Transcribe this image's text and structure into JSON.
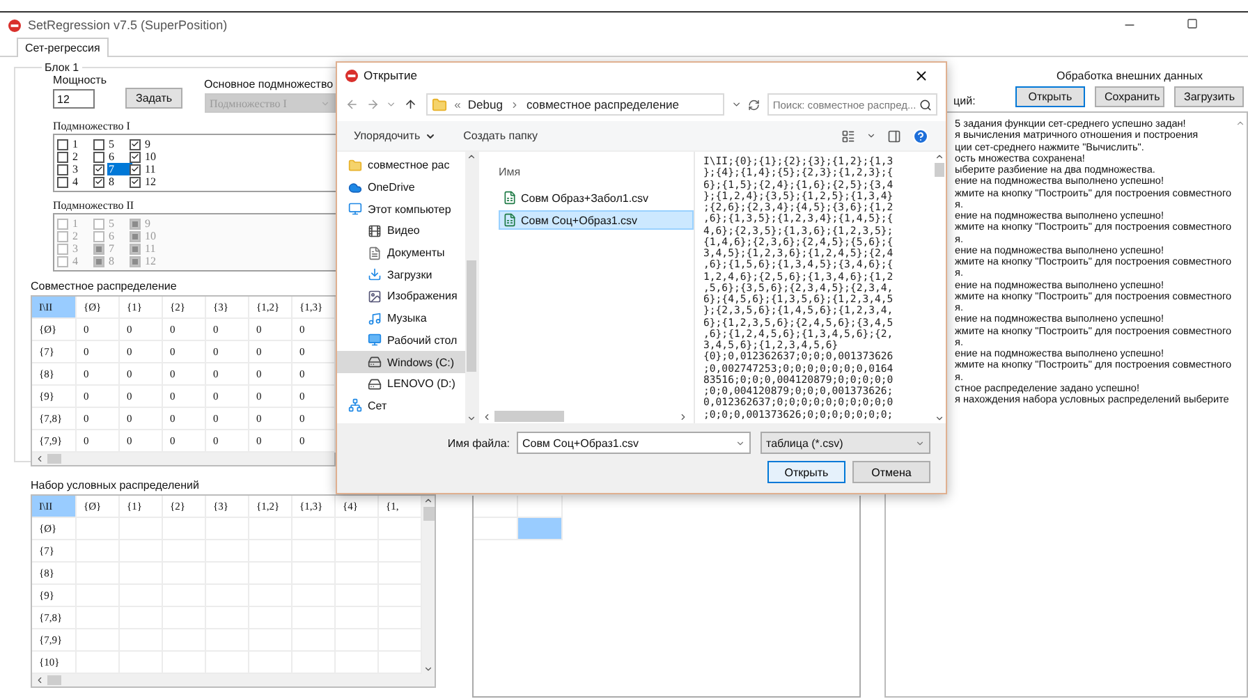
{
  "window": {
    "title": "SetRegression v7.5 (SuperPosition)"
  },
  "tabs": [
    {
      "label": "Сет-регрессия",
      "selected": true
    }
  ],
  "block": {
    "title": "Блок 1",
    "power_label": "Мощность",
    "power_value": "12",
    "set_button": "Задать",
    "main_subset_label": "Основное подмножество",
    "main_subset_value": "Подмножество I",
    "main_subset_disabled": true,
    "subset_1": {
      "label": "Подмножество I",
      "disabled": false,
      "items": [
        {
          "label": "1",
          "checked": false,
          "selected": false
        },
        {
          "label": "2",
          "checked": false,
          "selected": false
        },
        {
          "label": "3",
          "checked": false,
          "selected": false
        },
        {
          "label": "4",
          "checked": false,
          "selected": false
        },
        {
          "label": "5",
          "checked": false,
          "selected": false
        },
        {
          "label": "6",
          "checked": false,
          "selected": false
        },
        {
          "label": "7",
          "checked": true,
          "selected": true
        },
        {
          "label": "8",
          "checked": true,
          "selected": false
        },
        {
          "label": "9",
          "checked": true,
          "selected": false
        },
        {
          "label": "10",
          "checked": true,
          "selected": false
        },
        {
          "label": "11",
          "checked": true,
          "selected": false
        },
        {
          "label": "12",
          "checked": true,
          "selected": false
        }
      ]
    },
    "subset_2": {
      "label": "Подмножество II",
      "disabled": true,
      "items": [
        {
          "label": "1",
          "checked": false,
          "selected": false
        },
        {
          "label": "2",
          "checked": false,
          "selected": false
        },
        {
          "label": "3",
          "checked": false,
          "selected": false
        },
        {
          "label": "4",
          "checked": false,
          "selected": false
        },
        {
          "label": "5",
          "checked": false,
          "selected": false
        },
        {
          "label": "6",
          "checked": false,
          "selected": false
        },
        {
          "label": "7",
          "checked": true,
          "selected": false
        },
        {
          "label": "8",
          "checked": true,
          "selected": false
        },
        {
          "label": "9",
          "checked": true,
          "selected": false
        },
        {
          "label": "10",
          "checked": true,
          "selected": false
        },
        {
          "label": "11",
          "checked": true,
          "selected": false
        },
        {
          "label": "12",
          "checked": true,
          "selected": false
        }
      ]
    }
  },
  "joint": {
    "label": "Совместное распределение",
    "columns": [
      {
        "label": "I\\II",
        "selected": true
      },
      {
        "label": "{Ø}",
        "selected": false
      },
      {
        "label": "{1}",
        "selected": false
      },
      {
        "label": "{2}",
        "selected": false
      },
      {
        "label": "{3}",
        "selected": false
      },
      {
        "label": "{1,2}",
        "selected": false
      },
      {
        "label": "{1,3}",
        "selected": false
      }
    ],
    "rows": [
      {
        "cells": [
          "{Ø}",
          "0",
          "0",
          "0",
          "0",
          "0",
          "0"
        ]
      },
      {
        "cells": [
          "{7}",
          "0",
          "0",
          "0",
          "0",
          "0",
          "0"
        ]
      },
      {
        "cells": [
          "{8}",
          "0",
          "0",
          "0",
          "0",
          "0",
          "0"
        ]
      },
      {
        "cells": [
          "{9}",
          "0",
          "0",
          "0",
          "0",
          "0",
          "0"
        ]
      },
      {
        "cells": [
          "{7,8}",
          "0",
          "0",
          "0",
          "0",
          "0",
          "0"
        ]
      },
      {
        "cells": [
          "{7,9}",
          "0",
          "0",
          "0",
          "0",
          "0",
          "0"
        ]
      }
    ]
  },
  "conditional": {
    "label": "Набор условных распределений",
    "columns": [
      {
        "label": "I\\II",
        "selected": true
      },
      {
        "label": "{Ø}",
        "selected": false
      },
      {
        "label": "{1}",
        "selected": false
      },
      {
        "label": "{2}",
        "selected": false
      },
      {
        "label": "{3}",
        "selected": false
      },
      {
        "label": "{1,2}",
        "selected": false
      },
      {
        "label": "{1,3}",
        "selected": false
      },
      {
        "label": "{4}",
        "selected": false
      },
      {
        "label": "{1,",
        "selected": false
      }
    ],
    "rows": [
      "{Ø}",
      "{7}",
      "{8}",
      "{9}",
      "{7,8}",
      "{7,9}",
      "{10}"
    ]
  },
  "middle_grid": {
    "rows": [
      [
        {
          "selected": false
        },
        {
          "selected": false
        }
      ],
      [
        {
          "selected": false
        },
        {
          "selected": true
        }
      ]
    ]
  },
  "external": {
    "title": "Обработка внешних данных",
    "buttons": [
      {
        "label": "Открыть",
        "focused": true
      },
      {
        "label": "Сохранить",
        "focused": false
      },
      {
        "label": "Загрузить",
        "focused": false
      }
    ],
    "functions_label": "ций:",
    "log": [
      "5 задания функции сет-среднего успешно задан!",
      "я вычисления матричного отношения и построения",
      "ции сет-среднего нажмите \"Вычислить\".",
      "ость множества сохранена!",
      "ыберите разбиение на два подмножества.",
      "ение на подмножества выполнено успешно!",
      "жмите на кнопку \"Построить\" для построения совместного",
      "я.",
      "ение на подмножества выполнено успешно!",
      "жмите на кнопку \"Построить\" для построения совместного",
      "я.",
      "ение на подмножества выполнено успешно!",
      "жмите на кнопку \"Построить\" для построения совместного",
      "я.",
      "ение на подмножества выполнено успешно!",
      "жмите на кнопку \"Построить\" для построения совместного",
      "я.",
      "ение на подмножества выполнено успешно!",
      "жмите на кнопку \"Построить\" для построения совместного",
      "я.",
      "ение на подмножества выполнено успешно!",
      "жмите на кнопку \"Построить\" для построения совместного",
      "я.",
      "стное распределение задано успешно!",
      "я нахождения набора условных распределений выберите"
    ]
  },
  "dialog": {
    "title": "Открытие",
    "overflow_mark": "«",
    "path": [
      "Debug",
      "совместное распределение"
    ],
    "search": {
      "placeholder": "Поиск: совместное распред..."
    },
    "toolbar": [
      "Упорядочить",
      "Создать папку"
    ],
    "tree": [
      {
        "label": "совместное рас",
        "kind": "folder",
        "selected": false
      },
      {
        "label": "OneDrive",
        "kind": "cloud",
        "selected": false
      },
      {
        "label": "Этот компьютер",
        "kind": "computer",
        "selected": false,
        "children": [
          {
            "label": "Видео",
            "kind": "video",
            "selected": false
          },
          {
            "label": "Документы",
            "kind": "documents",
            "selected": false
          },
          {
            "label": "Загрузки",
            "kind": "downloads",
            "selected": false
          },
          {
            "label": "Изображения",
            "kind": "images",
            "selected": false
          },
          {
            "label": "Музыка",
            "kind": "music",
            "selected": false
          },
          {
            "label": "Рабочий стол",
            "kind": "desktop",
            "selected": false
          },
          {
            "label": "Windows (C:)",
            "kind": "drive",
            "selected": true
          },
          {
            "label": "LENOVO (D:)",
            "kind": "drive",
            "selected": false
          }
        ]
      },
      {
        "label": "Сет",
        "kind": "network",
        "selected": false
      }
    ],
    "file_column": "Имя",
    "files": [
      {
        "name": "Совм Образ+Забол1.csv",
        "selected": false
      },
      {
        "name": "Совм Соц+Образ1.csv",
        "selected": true
      }
    ],
    "preview": [
      "I\\II;{0};{1};{2};{3};{1,2};{1,3",
      "};{4};{1,4};{5};{2,3};{1,2,3};{",
      "6};{1,5};{2,4};{1,6};{2,5};{3,4",
      "};{1,2,4};{3,5};{1,2,5};{1,3,4}",
      ";{2,6};{2,3,4};{4,5};{3,6};{1,2",
      ",6};{1,3,5};{1,2,3,4};{1,4,5};{",
      "4,6};{2,3,5};{1,3,6};{1,2,3,5};",
      "{1,4,6};{2,3,6};{2,4,5};{5,6};{",
      "3,4,5};{1,2,3,6};{1,2,4,5};{2,4",
      ",6};{1,5,6};{1,3,4,5};{3,4,6};{",
      "1,2,4,6};{2,5,6};{1,3,4,6};{1,2",
      ",5,6};{3,5,6};{2,3,4,5};{2,3,4,",
      "6};{4,5,6};{1,3,5,6};{1,2,3,4,5",
      "};{2,3,5,6};{1,4,5,6};{1,2,3,4,",
      "6};{1,2,3,5,6};{2,4,5,6};{3,4,5",
      ",6};{1,2,4,5,6};{1,3,4,5,6};{2,",
      "3,4,5,6};{1,2,3,4,5,6}",
      "{0};0,012362637;0;0;0,001373626",
      ";0,002747253;0;0;0;0;0;0;0,0164",
      "83516;0;0;0,004120879;0;0;0;0;0",
      ";0;0,004120879;0;0;0,001373626;",
      "0,012362637;0;0;0;0;0;0;0;0;0;0",
      ";0;0;0,001373626;0;0;0;0;0;0;0;"
    ],
    "file_name_label": "Имя файла:",
    "file_name": "Совм Соц+Образ1.csv",
    "file_type": "таблица (*.csv)",
    "buttons": [
      {
        "label": "Открыть",
        "default": true
      },
      {
        "label": "Отмена",
        "default": false
      }
    ]
  }
}
